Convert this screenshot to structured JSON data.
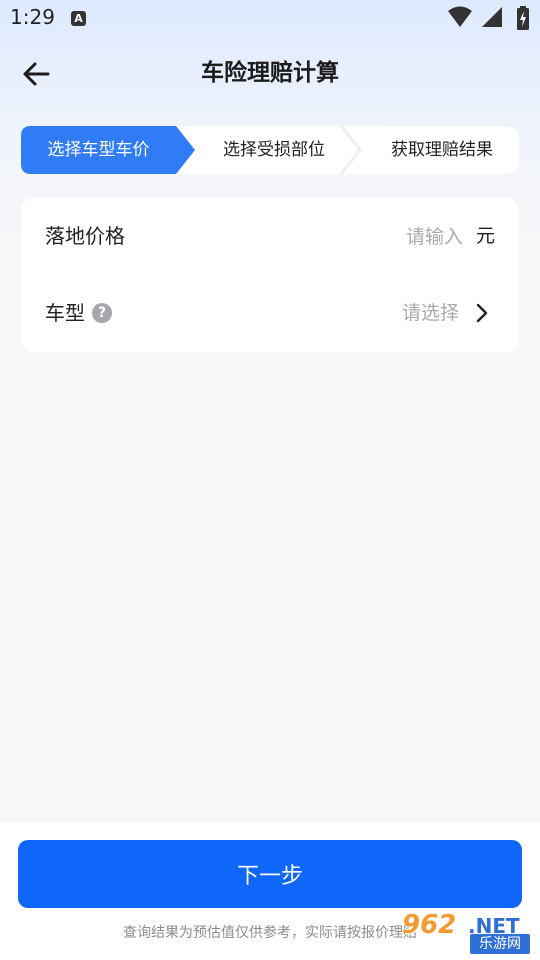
{
  "status_bar": {
    "time": "1:29",
    "notification_badge": "A",
    "icons": [
      "wifi-icon",
      "signal-icon",
      "battery-charging-icon"
    ]
  },
  "header": {
    "title": "车险理赔计算",
    "back_icon": "back-arrow-icon"
  },
  "stepper": {
    "steps": [
      {
        "label": "选择车型车价",
        "active": true
      },
      {
        "label": "选择受损部位",
        "active": false
      },
      {
        "label": "获取理赔结果",
        "active": false
      }
    ],
    "active_color": "#2f7cf6"
  },
  "form": {
    "price": {
      "label": "落地价格",
      "placeholder": "请输入",
      "value": "",
      "unit": "元"
    },
    "car_model": {
      "label": "车型",
      "help_icon": "question-icon",
      "help_symbol": "?",
      "value_placeholder": "请选择",
      "chevron_icon": "chevron-right-icon"
    }
  },
  "footer": {
    "next_label": "下一步",
    "disclaimer": "查询结果为预估值仅供参考，实际请按报价理赔",
    "button_color": "#0f66fa"
  },
  "watermark": {
    "number": "962",
    "domain": ".NET",
    "site": "乐游网"
  }
}
